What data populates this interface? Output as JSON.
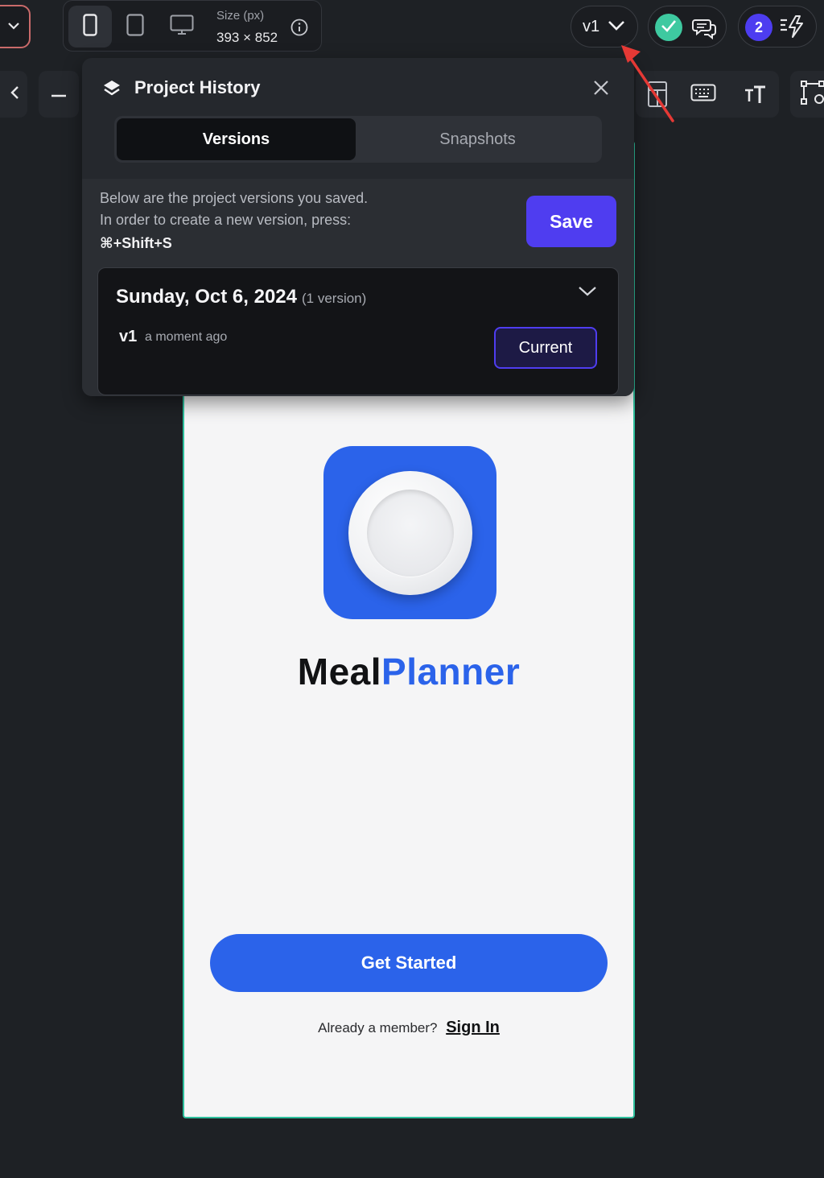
{
  "toolbar": {
    "size_label": "Size (px)",
    "size_value": "393 × 852",
    "version_label": "v1",
    "user_count": "2",
    "icons": [
      "chevron-down-icon",
      "phone-icon",
      "tablet-icon",
      "desktop-icon",
      "info-icon",
      "check-icon",
      "chat-icon",
      "bolt-icon"
    ]
  },
  "secondary_toolbar": {
    "icons": [
      "collapse-icon",
      "zoom-out-icon",
      "table-icon",
      "keyboard-icon",
      "text-size-icon",
      "components-icon"
    ]
  },
  "history_panel": {
    "title": "Project History",
    "tabs": [
      {
        "label": "Versions",
        "active": true
      },
      {
        "label": "Snapshots",
        "active": false
      }
    ],
    "description_line1": "Below are the project versions you saved.",
    "description_line2": "In order to create a new version, press:",
    "shortcut": "⌘+Shift+S",
    "save_label": "Save",
    "group": {
      "date": "Sunday, Oct 6, 2024",
      "count": "(1 version)",
      "versions": [
        {
          "name": "v1",
          "time": "a moment ago",
          "status": "Current"
        }
      ]
    }
  },
  "app_preview": {
    "brand_part1": "Meal",
    "brand_part2": "Planner",
    "cta_label": "Get Started",
    "signin_prompt": "Already a member?",
    "signin_link": "Sign In"
  },
  "colors": {
    "accent": "#4f3df0",
    "app_blue": "#2b63ea",
    "success": "#3ec9a0",
    "annotation": "#e53935"
  }
}
